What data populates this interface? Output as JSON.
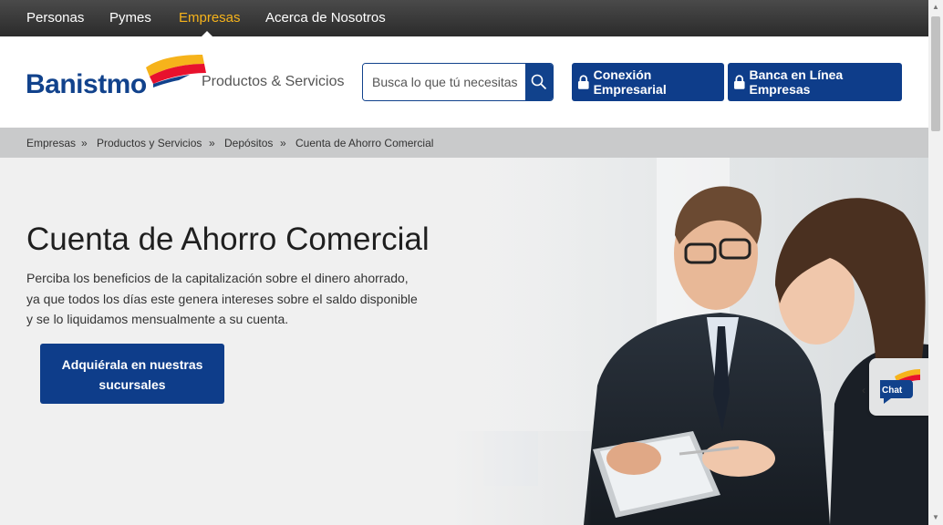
{
  "topnav": {
    "items": [
      "Personas",
      "Pymes",
      "Empresas",
      "Acerca de Nosotros"
    ],
    "active": "Empresas"
  },
  "header": {
    "logo_text": "Banistmo",
    "products_link": "Productos & Servicios",
    "search_placeholder": "Busca lo que tú necesitas",
    "btn_conexion": "Conexión Empresarial",
    "btn_banca": "Banca en Línea Empresas"
  },
  "breadcrumb": {
    "items": [
      "Empresas",
      "Productos y Servicios",
      "Depósitos",
      "Cuenta de Ahorro Comercial"
    ],
    "separator": "»"
  },
  "hero": {
    "title": "Cuenta de Ahorro Comercial",
    "line1": "Perciba los beneficios de la capitalización sobre el dinero ahorrado,",
    "line2": "ya que todos los días este genera intereses sobre el saldo disponible",
    "line3": "y se lo liquidamos mensualmente a su cuenta.",
    "cta_line1": "Adquiérala en nuestras",
    "cta_line2": "sucursales"
  },
  "chat": {
    "label": "Chat",
    "arrow": "‹"
  },
  "colors": {
    "brand_blue": "#11428c",
    "active_nav": "#f6b31b",
    "logo_yellow": "#f6b31b",
    "logo_red": "#e8112d"
  },
  "icons": [
    "search-icon",
    "lock-icon",
    "chat-icon",
    "chevron-left-icon"
  ]
}
